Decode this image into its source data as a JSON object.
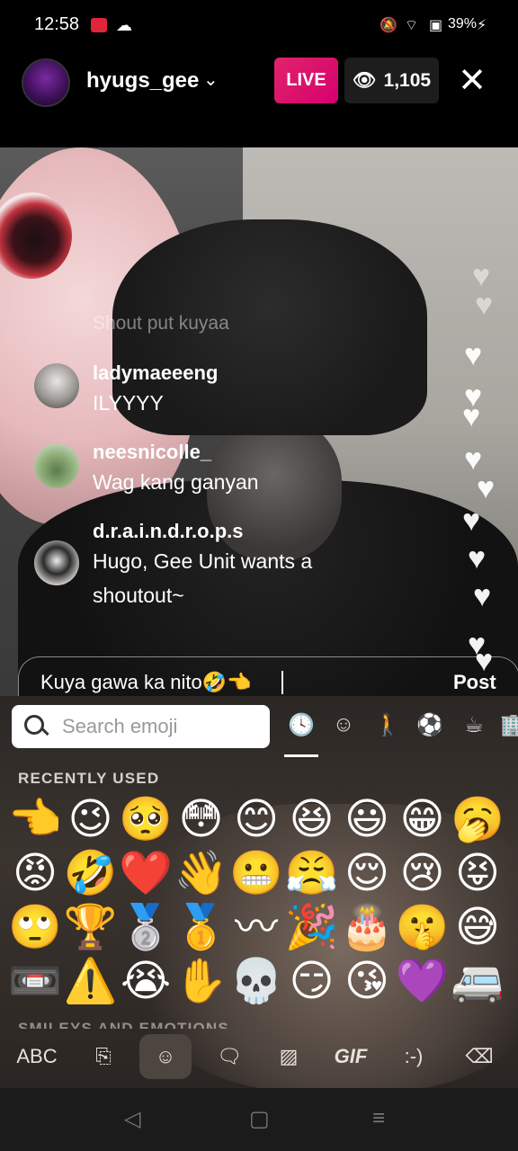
{
  "status_bar": {
    "time": "12:58",
    "battery": "39%",
    "icons": [
      "screen-record-icon",
      "cloud-icon",
      "mute-icon",
      "wifi-icon",
      "sim-icon",
      "battery-icon"
    ]
  },
  "header": {
    "username": "hyugs_gee",
    "live_label": "LIVE",
    "viewer_count": "1,105",
    "accent": "#e0246a"
  },
  "comments": [
    {
      "user": "",
      "text": "Shout put kuyaa",
      "faded": true
    },
    {
      "user": "ladymaeeeng",
      "text": "ILYYYY"
    },
    {
      "user": "neesnicolle_",
      "text": "Wag kang ganyan"
    },
    {
      "user": "d.r.a.i.n.d.r.o.p.s",
      "text": "Hugo, Gee Unit wants a shoutout~"
    }
  ],
  "comment_input": {
    "value": "Kuya gawa ka nito🤣👈",
    "post_label": "Post"
  },
  "emoji_keyboard": {
    "search_placeholder": "Search emoji",
    "categories": [
      "recent-icon",
      "smileys-icon",
      "people-icon",
      "activities-icon",
      "food-icon",
      "objects-icon"
    ],
    "recent_label": "RECENTLY USED",
    "section_peek": "SMILEYS AND EMOTIONS",
    "recent_emojis": [
      "👈",
      "😉",
      "🥺",
      "😳",
      "😊",
      "😆",
      "😃",
      "😁",
      "🥱",
      "😡",
      "🤣",
      "❤️",
      "👋",
      "😬",
      "😤",
      "😌",
      "😢",
      "😝",
      "🙄",
      "🏆",
      "🥈",
      "🥇",
      "〰",
      "🎉",
      "🎂",
      "🤫",
      "😅",
      "📼",
      "⚠️",
      "😭",
      "✋",
      "💀",
      "😏",
      "😘",
      "💜",
      "🚐"
    ],
    "toolbar": {
      "abc": "ABC",
      "gif": "GIF",
      "emoticon": ":-)"
    }
  }
}
